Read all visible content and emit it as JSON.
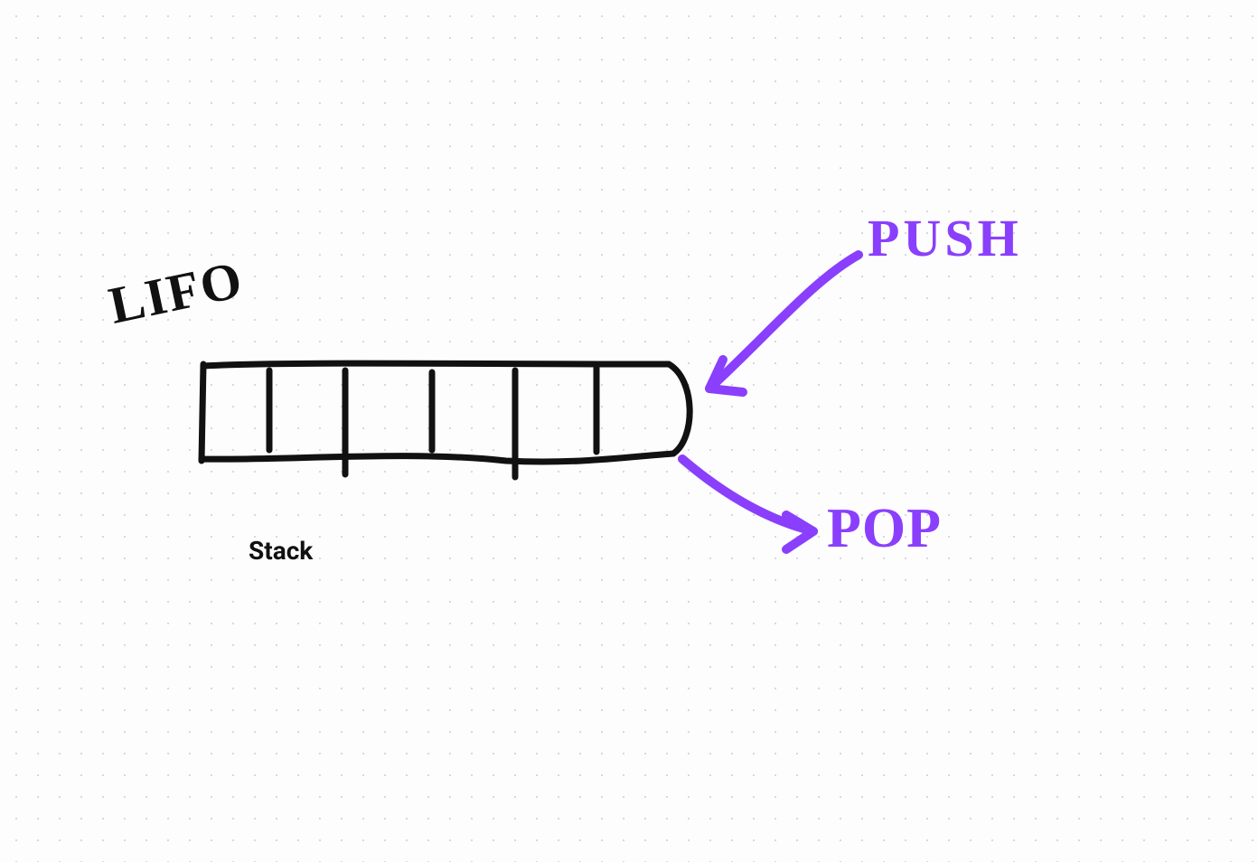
{
  "diagram": {
    "title": "Stack",
    "principle": "LIFO",
    "operations": {
      "push": "PUSH",
      "pop": "POP"
    },
    "slot_count": 6,
    "colors": {
      "stroke": "#111111",
      "accent": "#8a3ffc"
    }
  }
}
